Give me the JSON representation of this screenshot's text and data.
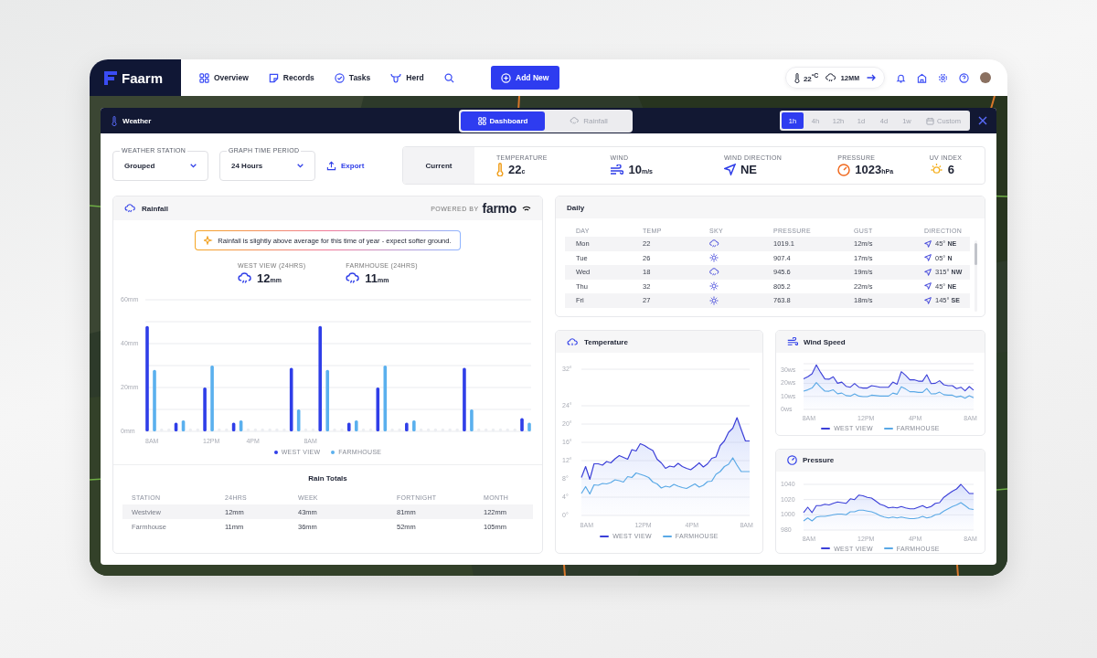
{
  "app": {
    "logo": "Faarm"
  },
  "nav": [
    {
      "label": "Overview"
    },
    {
      "label": "Records"
    },
    {
      "label": "Tasks"
    },
    {
      "label": "Herd"
    }
  ],
  "add_button": "Add New",
  "top_weather": {
    "temp": "22",
    "temp_unit": "ºC",
    "rain": "12",
    "rain_unit": "MM"
  },
  "weather_panel": {
    "title": "Weather",
    "view_tabs": [
      {
        "label": "Dashboard",
        "selected": true
      },
      {
        "label": "Rainfall",
        "selected": false
      }
    ],
    "ranges": [
      {
        "label": "1h",
        "selected": true
      },
      {
        "label": "4h",
        "selected": false
      },
      {
        "label": "12h",
        "selected": false
      },
      {
        "label": "1d",
        "selected": false
      },
      {
        "label": "4d",
        "selected": false
      },
      {
        "label": "1w",
        "selected": false
      },
      {
        "label": "Custom",
        "selected": false
      }
    ]
  },
  "filters": [
    {
      "label": "WEATHER STATION",
      "value": "Grouped"
    },
    {
      "label": "GRAPH TIME PERIOD",
      "value": "24 Hours"
    }
  ],
  "export": "Export",
  "current": {
    "label": "Current",
    "stats": [
      {
        "label": "TEMPERATURE",
        "value": "22",
        "unit": "c"
      },
      {
        "label": "WIND",
        "value": "10",
        "unit": "m/s"
      },
      {
        "label": "WIND DIRECTION",
        "value": "NE"
      },
      {
        "label": "PRESSURE",
        "value": "1023",
        "unit": "hPa"
      },
      {
        "label": "UV INDEX",
        "value": "6"
      }
    ]
  },
  "rainfall": {
    "title": "Rainfall",
    "powered_by": "POWERED BY",
    "brand": "farmo",
    "insight": "Rainfall is slightly above average for this time of year - expect softer ground.",
    "totals": [
      {
        "label": "WEST VIEW (24HRS)",
        "value": "12",
        "unit": "mm"
      },
      {
        "label": "FARMHOUSE (24HRS)",
        "value": "11",
        "unit": "mm"
      }
    ],
    "chart_data": {
      "type": "bar",
      "grid": true,
      "categories": [
        "8AM",
        null,
        null,
        null,
        "12PM",
        null,
        null,
        "4PM",
        null,
        null,
        null,
        "8AM",
        null,
        null,
        null,
        null,
        null,
        null,
        null,
        null,
        null,
        null,
        null,
        null,
        null,
        null,
        null
      ],
      "ylim": [
        0,
        60
      ],
      "yticks": [
        {
          "value": 0,
          "label": "0mm"
        },
        {
          "value": 20,
          "label": "20mm"
        },
        {
          "value": 40,
          "label": "40mm"
        },
        {
          "value": 60,
          "label": "60mm"
        }
      ],
      "series": [
        {
          "name": "WEST VIEW",
          "color": "#2f3ee8",
          "values": [
            48,
            0,
            4,
            0,
            20,
            0,
            4,
            0,
            0,
            0,
            29,
            0,
            48,
            0,
            4,
            0,
            20,
            0,
            4,
            0,
            0,
            0,
            29,
            0,
            0,
            0,
            6
          ]
        },
        {
          "name": "FARMHOUSE",
          "color": "#5ab0ee",
          "values": [
            28,
            0,
            5,
            0,
            30,
            0,
            5,
            0,
            0,
            0,
            10,
            0,
            28,
            0,
            5,
            0,
            30,
            0,
            5,
            0,
            0,
            0,
            10,
            0,
            0,
            0,
            4
          ]
        }
      ]
    },
    "rain_totals": {
      "title": "Rain Totals",
      "columns": [
        "STATION",
        "24HRS",
        "WEEK",
        "FORTNIGHT",
        "MONTH"
      ],
      "rows": [
        [
          "Westview",
          "12mm",
          "43mm",
          "81mm",
          "122mm"
        ],
        [
          "Farmhouse",
          "11mm",
          "36mm",
          "52mm",
          "105mm"
        ]
      ]
    }
  },
  "daily": {
    "title": "Daily",
    "columns": [
      "DAY",
      "TEMP",
      "SKY",
      "PRESSURE",
      "GUST",
      "DIRECTION"
    ],
    "rows": [
      {
        "day": "Mon",
        "temp": "22",
        "kind": "rain",
        "pressure": "1019.1",
        "gust": "12m/s",
        "direction": "45°",
        "compass": "NE"
      },
      {
        "day": "Tue",
        "temp": "26",
        "kind": "sun",
        "pressure": "907.4",
        "gust": "17m/s",
        "direction": "05°",
        "compass": "N"
      },
      {
        "day": "Wed",
        "temp": "18",
        "kind": "rain",
        "pressure": "945.6",
        "gust": "19m/s",
        "direction": "315°",
        "compass": "NW"
      },
      {
        "day": "Thu",
        "temp": "32",
        "kind": "sun",
        "pressure": "805.2",
        "gust": "22m/s",
        "direction": "45°",
        "compass": "NE"
      },
      {
        "day": "Fri",
        "temp": "27",
        "kind": "sun",
        "pressure": "763.8",
        "gust": "18m/s",
        "direction": "145°",
        "compass": "SE"
      }
    ]
  },
  "temperature": {
    "title": "Temperature",
    "chart_data": {
      "type": "area",
      "grid": true,
      "categories": [
        null,
        "8AM",
        null,
        null,
        null,
        null,
        null,
        null,
        null,
        null,
        null,
        null,
        null,
        null,
        "12PM",
        null,
        null,
        null,
        null,
        null,
        null,
        null,
        null,
        null,
        null,
        null,
        "4PM",
        null,
        null,
        null,
        null,
        null,
        null,
        null,
        null,
        null,
        null,
        null,
        null,
        "8AM",
        null
      ],
      "ylim": [
        0,
        32
      ],
      "yticks": [
        {
          "value": 0,
          "label": "0°"
        },
        {
          "value": 4,
          "label": "4°"
        },
        {
          "value": 8,
          "label": "8°"
        },
        {
          "value": 12,
          "label": "12°"
        },
        {
          "value": 16,
          "label": "16°"
        },
        {
          "value": 20,
          "label": "20°"
        },
        {
          "value": 24,
          "label": "24°"
        },
        {
          "value": 32,
          "label": "32°"
        }
      ],
      "series": [
        {
          "name": "WEST VIEW",
          "type": "area",
          "color": "#3b3fd8",
          "values": [
            8.3,
            10.7,
            7.9,
            11.3,
            11.3,
            11.0,
            11.8,
            11.5,
            12.4,
            13.1,
            12.7,
            12.3,
            14.4,
            14.1,
            15.7,
            15.3,
            14.7,
            14.2,
            12.3,
            11.5,
            10.3,
            10.8,
            10.6,
            11.4,
            10.7,
            10.3,
            10.0,
            10.7,
            11.5,
            10.6,
            11.3,
            12.5,
            12.8,
            15.3,
            16.3,
            18.2,
            19.1,
            21.4,
            18.8,
            16.3,
            16.3
          ]
        },
        {
          "name": "FARMHOUSE",
          "type": "line",
          "color": "#5aa9e6",
          "values": [
            4.8,
            6.3,
            4.7,
            6.7,
            6.6,
            7.0,
            6.9,
            7.2,
            7.8,
            7.6,
            7.3,
            8.5,
            8.3,
            9.3,
            9.0,
            8.7,
            8.3,
            7.3,
            6.9,
            6.0,
            6.4,
            6.2,
            6.8,
            6.4,
            6.1,
            5.9,
            6.4,
            6.9,
            6.2,
            6.6,
            7.4,
            7.5,
            9.0,
            9.6,
            10.7,
            11.2,
            12.6,
            11.0,
            9.6,
            9.6,
            9.6
          ]
        }
      ]
    }
  },
  "wind_speed": {
    "title": "Wind Speed",
    "chart_data": {
      "type": "area",
      "grid": true,
      "categories": [
        null,
        "8AM",
        null,
        null,
        null,
        null,
        null,
        null,
        null,
        null,
        null,
        null,
        null,
        null,
        "12PM",
        null,
        null,
        null,
        null,
        null,
        null,
        null,
        null,
        null,
        null,
        null,
        "4PM",
        null,
        null,
        null,
        null,
        null,
        null,
        null,
        null,
        null,
        null,
        null,
        null,
        "8AM",
        null
      ],
      "ylim": [
        0,
        35
      ],
      "yticks": [
        {
          "value": 0,
          "label": "0ws"
        },
        {
          "value": 10,
          "label": "10ws"
        },
        {
          "value": 20,
          "label": "20ws"
        },
        {
          "value": 30,
          "label": "30ws"
        }
      ],
      "series": [
        {
          "name": "WEST VIEW",
          "type": "area",
          "color": "#3b3fd8",
          "values": [
            23.4,
            25,
            27.3,
            34.1,
            28.4,
            23.4,
            23.2,
            25,
            20,
            20.9,
            17.7,
            17,
            19.8,
            17,
            16.4,
            16.4,
            18.2,
            17.7,
            17,
            17,
            17,
            20.9,
            19.3,
            28.9,
            26.1,
            22.7,
            22.7,
            21.6,
            21.6,
            26.6,
            19.8,
            20,
            22,
            18.9,
            18.2,
            18.2,
            15.9,
            17,
            14.3,
            17.5,
            14.8
          ]
        },
        {
          "name": "FARMHOUSE",
          "type": "line",
          "color": "#5aa9e6",
          "values": [
            14,
            15,
            16.4,
            20.5,
            17,
            14,
            13.9,
            15,
            12,
            12.5,
            10.6,
            10.2,
            11.9,
            10.2,
            9.8,
            9.8,
            10.9,
            10.6,
            10.2,
            10.2,
            10.2,
            12.5,
            11.6,
            17.3,
            15.7,
            13.6,
            13.6,
            13,
            13,
            16,
            11.9,
            12,
            13.2,
            11.3,
            10.9,
            10.9,
            9.5,
            10.2,
            8.6,
            10.5,
            8.9
          ]
        }
      ]
    }
  },
  "pressure": {
    "title": "Pressure",
    "chart_data": {
      "type": "area",
      "grid": true,
      "categories": [
        null,
        "8AM",
        null,
        null,
        null,
        null,
        null,
        null,
        null,
        null,
        null,
        null,
        null,
        null,
        "12PM",
        null,
        null,
        null,
        null,
        null,
        null,
        null,
        null,
        null,
        null,
        null,
        "4PM",
        null,
        null,
        null,
        null,
        null,
        null,
        null,
        null,
        null,
        null,
        null,
        null,
        "8AM",
        null
      ],
      "ylim": [
        980,
        1040
      ],
      "yticks": [
        980,
        1000,
        1020,
        1040
      ],
      "series": [
        {
          "name": "WEST VIEW",
          "type": "area",
          "color": "#3b3fd8",
          "values": [
            1003,
            1010,
            1003,
            1012,
            1012,
            1014,
            1013,
            1015,
            1017,
            1016,
            1015,
            1021,
            1020,
            1026,
            1025,
            1023,
            1022,
            1018,
            1014,
            1012,
            1009,
            1010,
            1009,
            1011,
            1009,
            1008,
            1008,
            1010,
            1012,
            1009,
            1011,
            1015,
            1016,
            1023,
            1027,
            1031,
            1034,
            1040,
            1034,
            1028,
            1028
          ]
        },
        {
          "name": "FARMHOUSE",
          "type": "line",
          "color": "#5aa9e6",
          "values": [
            992,
            996,
            992,
            997,
            998,
            998,
            999,
            1000,
            1001,
            1001,
            1000,
            1004,
            1004,
            1006,
            1006,
            1005,
            1004,
            1002,
            999,
            997,
            996,
            997,
            996,
            997,
            996,
            995,
            995,
            996,
            998,
            996,
            997,
            1000,
            1001,
            1005,
            1008,
            1011,
            1013,
            1016,
            1012,
            1008,
            1007
          ]
        }
      ]
    }
  }
}
